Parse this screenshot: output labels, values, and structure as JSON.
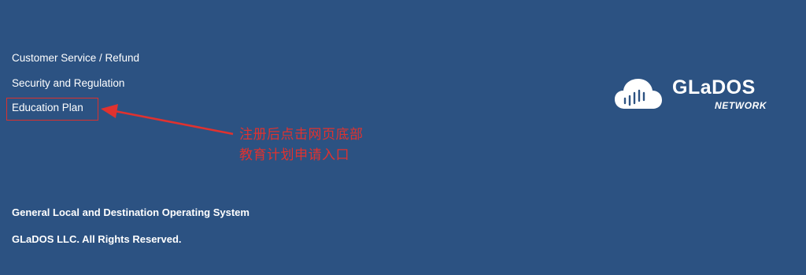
{
  "footer": {
    "links": [
      {
        "label": "Customer Service / Refund"
      },
      {
        "label": "Security and Regulation"
      },
      {
        "label": "Education Plan"
      }
    ],
    "tagline": "General Local and Destination Operating System",
    "copyright": "GLaDOS LLC. All Rights Reserved."
  },
  "annotation": {
    "line1": "注册后点击网页底部",
    "line2": "教育计划申请入口",
    "color": "#e0322f"
  },
  "logo": {
    "name": "GLaDOS",
    "subtitle": "NETWORK",
    "icon": "cloud-icon"
  },
  "colors": {
    "background": "#2c5282",
    "text": "#ffffff",
    "highlight": "#d9312e"
  }
}
